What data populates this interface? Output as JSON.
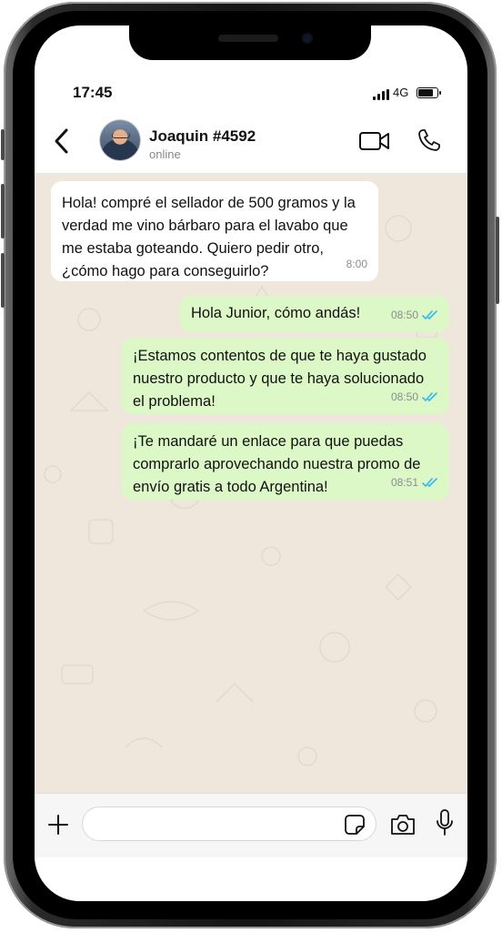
{
  "status_bar": {
    "time": "17:45",
    "network": "4G"
  },
  "header": {
    "contact_name": "Joaquin #4592",
    "contact_status": "online"
  },
  "messages": [
    {
      "direction": "incoming",
      "text": "Hola! compré el sellador de 500 gramos y la verdad me vino bárbaro para el lavabo que me estaba goteando. Quiero pedir otro, ¿cómo hago para conseguirlo?",
      "time": "8:00"
    },
    {
      "direction": "outgoing",
      "text": "Hola Junior, cómo andás!",
      "time": "08:50"
    },
    {
      "direction": "outgoing",
      "text": "¡Estamos contentos de que te haya gustado nuestro producto y que te haya solucionado el problema!",
      "time": "08:50"
    },
    {
      "direction": "outgoing",
      "text": "¡Te mandaré un enlace para que puedas comprarlo aprovechando nuestra promo de envío gratis a todo Argentina!",
      "time": "08:51"
    }
  ],
  "input": {
    "value": "",
    "placeholder": ""
  },
  "colors": {
    "incoming_bubble": "#ffffff",
    "outgoing_bubble": "#dcf8c6",
    "read_ticks": "#34b7f1",
    "chat_background": "#efe7dc"
  },
  "icons": {
    "back": "chevron-left-icon",
    "video": "video-camera-icon",
    "call": "phone-icon",
    "plus": "plus-icon",
    "sticker": "sticker-icon",
    "camera": "camera-icon",
    "mic": "microphone-icon"
  }
}
